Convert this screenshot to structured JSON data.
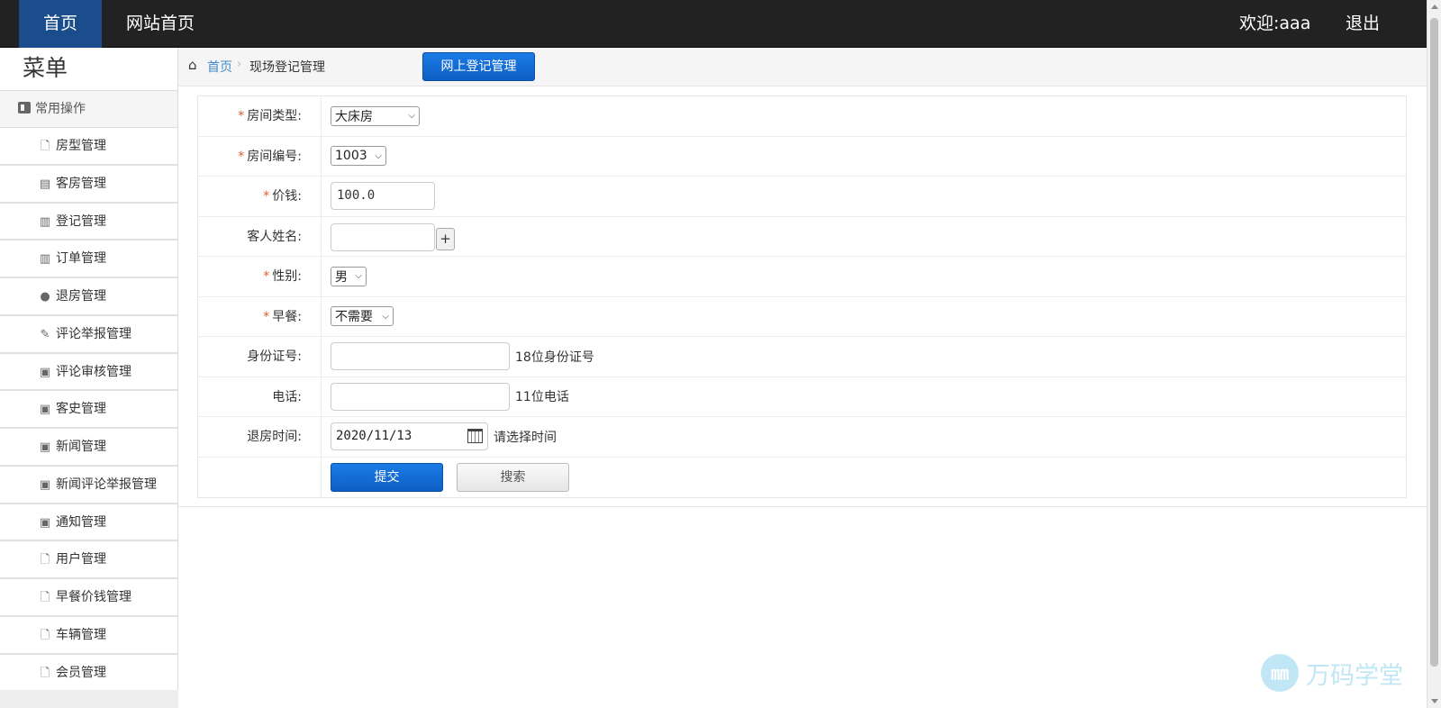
{
  "topbar": {
    "home": "首页",
    "site_home": "网站首页",
    "welcome": "欢迎:aaa",
    "logout": "退出"
  },
  "sidebar": {
    "title": "菜单",
    "group": "常用操作",
    "items": [
      {
        "label": "房型管理",
        "icon": "file-icon"
      },
      {
        "label": "客房管理",
        "icon": "list-icon"
      },
      {
        "label": "登记管理",
        "icon": "books-icon"
      },
      {
        "label": "订单管理",
        "icon": "books-icon"
      },
      {
        "label": "退房管理",
        "icon": "comment-icon"
      },
      {
        "label": "评论举报管理",
        "icon": "pushpin-icon"
      },
      {
        "label": "评论审核管理",
        "icon": "picture-icon"
      },
      {
        "label": "客史管理",
        "icon": "picture-icon"
      },
      {
        "label": "新闻管理",
        "icon": "picture-icon"
      },
      {
        "label": "新闻评论举报管理",
        "icon": "picture-icon"
      },
      {
        "label": "通知管理",
        "icon": "picture-icon"
      },
      {
        "label": "用户管理",
        "icon": "file-icon"
      },
      {
        "label": "早餐价钱管理",
        "icon": "file-icon"
      },
      {
        "label": "车辆管理",
        "icon": "file-icon"
      },
      {
        "label": "会员管理",
        "icon": "file-icon"
      }
    ]
  },
  "breadcrumb": {
    "home": "首页",
    "current": "现场登记管理",
    "online_button": "网上登记管理"
  },
  "form": {
    "room_type": {
      "label": "房间类型:",
      "value": "大床房"
    },
    "room_number": {
      "label": "房间编号:",
      "value": "1003"
    },
    "price": {
      "label": "价钱:",
      "value": "100.0"
    },
    "guest_name": {
      "label": "客人姓名:",
      "value": "",
      "add": "+"
    },
    "gender": {
      "label": "性别:",
      "value": "男"
    },
    "breakfast": {
      "label": "早餐:",
      "value": "不需要"
    },
    "id_number": {
      "label": "身份证号:",
      "value": "",
      "hint": "18位身份证号"
    },
    "phone": {
      "label": "电话:",
      "value": "",
      "hint": "11位电话"
    },
    "checkout_time": {
      "label": "退房时间:",
      "value": "2020/11/13",
      "hint": "请选择时间"
    },
    "submit": "提交",
    "search": "搜索",
    "required_mark": "*"
  },
  "watermark": {
    "logo": "㎜",
    "text": "万码学堂"
  },
  "colors": {
    "topbar": "#222222",
    "active_nav": "#1b4d8c",
    "primary_button": "#0e5fc4",
    "required": "#e05c2b",
    "link": "#428bca"
  }
}
